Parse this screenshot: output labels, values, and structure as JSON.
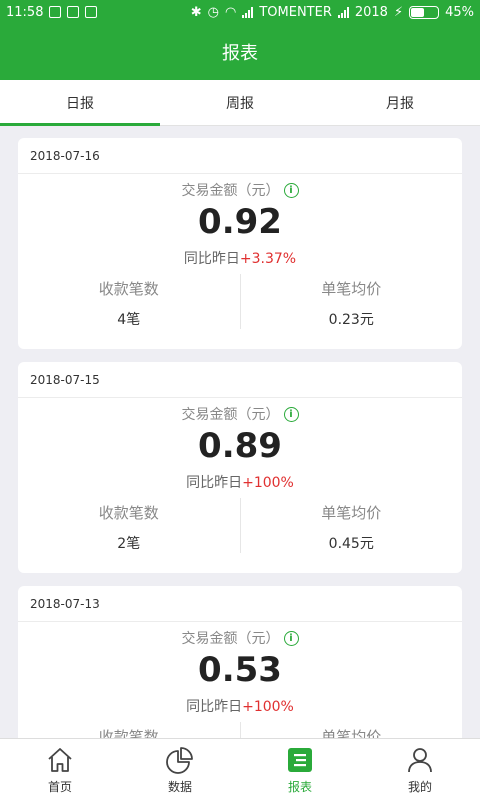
{
  "status_bar": {
    "time": "11:58",
    "carrier": "TOMENTER",
    "carrier2": "2018",
    "battery_text": "45%",
    "battery_level": 0.45
  },
  "app_bar": {
    "title": "报表"
  },
  "tabs": [
    {
      "label": "日报",
      "active": true
    },
    {
      "label": "周报",
      "active": false
    },
    {
      "label": "月报",
      "active": false
    }
  ],
  "cards": [
    {
      "date": "2018-07-16",
      "amount_label": "交易金额（元）",
      "amount": "0.92",
      "compare_label": "同比昨日",
      "compare_delta": "+3.37%",
      "count_label": "收款笔数",
      "count_value": "4笔",
      "avg_label": "单笔均价",
      "avg_value": "0.23元"
    },
    {
      "date": "2018-07-15",
      "amount_label": "交易金额（元）",
      "amount": "0.89",
      "compare_label": "同比昨日",
      "compare_delta": "+100%",
      "count_label": "收款笔数",
      "count_value": "2笔",
      "avg_label": "单笔均价",
      "avg_value": "0.45元"
    },
    {
      "date": "2018-07-13",
      "amount_label": "交易金额（元）",
      "amount": "0.53",
      "compare_label": "同比昨日",
      "compare_delta": "+100%",
      "count_label": "收款笔数",
      "count_value": "",
      "avg_label": "单笔均价",
      "avg_value": ""
    }
  ],
  "bottom_nav": [
    {
      "label": "首页",
      "icon": "home-icon",
      "active": false
    },
    {
      "label": "数据",
      "icon": "pie-chart-icon",
      "active": false
    },
    {
      "label": "报表",
      "icon": "report-list-icon",
      "active": true
    },
    {
      "label": "我的",
      "icon": "user-icon",
      "active": false
    }
  ],
  "colors": {
    "primary": "#2aaa3a",
    "increase": "#e03030",
    "background": "#eeeef3"
  }
}
